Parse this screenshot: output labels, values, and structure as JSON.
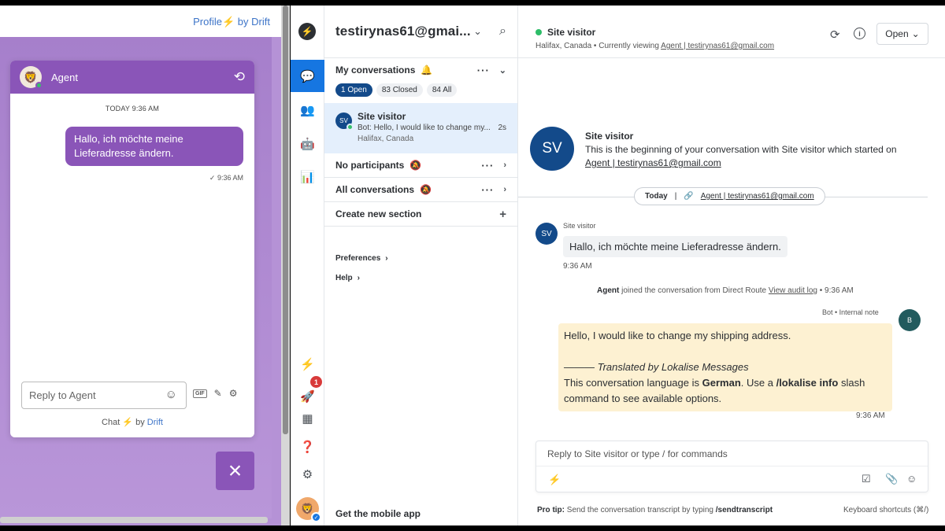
{
  "preview": {
    "profile_label": "Profile",
    "by_label": "by",
    "brand": "Drift",
    "widget": {
      "agent_name": "Agent",
      "date_label": "TODAY 9:36 AM",
      "message": "Hallo, ich möchte meine Lieferadresse ändern.",
      "message_time": "9:36 AM",
      "input_placeholder": "Reply to Agent",
      "gif_label": "GIF",
      "footer_chat": "Chat",
      "footer_by": "by",
      "footer_brand": "Drift"
    },
    "close_icon": "×"
  },
  "rail": {
    "badge_count": "1",
    "accent": "#1676e1"
  },
  "convlist": {
    "account": "testirynas61@gmai...",
    "my_conversations": "My conversations",
    "pills": [
      "1 Open",
      "83 Closed",
      "84 All"
    ],
    "conversation": {
      "avatar": "SV",
      "name": "Site visitor",
      "preview": "Bot: Hello, I would like to change my...",
      "location": "Halifax, Canada",
      "ago": "2s"
    },
    "no_participants": "No participants",
    "all_conversations": "All conversations",
    "create_section": "Create new section",
    "preferences": "Preferences",
    "help": "Help",
    "mobile": "Get the mobile app"
  },
  "main": {
    "visitor_name": "Site visitor",
    "location": "Halifax, Canada",
    "currently_viewing": "Currently viewing",
    "viewing_link": "Agent | testirynas61@gmail.com",
    "open_label": "Open",
    "intro": {
      "avatar": "SV",
      "name": "Site visitor",
      "text": "This is the beginning of your conversation with Site visitor which started on",
      "link": "Agent | testirynas61@gmail.com"
    },
    "day_chip": {
      "day": "Today",
      "sep": "|",
      "link": "Agent | testirynas61@gmail.com"
    },
    "visitor_msg": {
      "avatar": "SV",
      "name": "Site visitor",
      "text": "Hallo, ich möchte meine Lieferadresse ändern.",
      "time": "9:36 AM"
    },
    "join": {
      "who": "Agent",
      "text": "joined the conversation from Direct Route",
      "link": "View audit log",
      "time": "• 9:36 AM"
    },
    "bot_note": {
      "meta": "Bot • Internal note",
      "avatar": "B",
      "line1": "Hello, I would like to change my shipping address.",
      "line2": "——— Translated by Lokalise Messages",
      "line3_a": "This conversation language is",
      "line3_b": "German",
      "line3_c": ". Use a",
      "line3_d": "/lokalise info",
      "line3_e": "slash",
      "line4": "command to see available options.",
      "time": "9:36 AM"
    },
    "composer_placeholder": "Reply to Site visitor or type / for commands",
    "tip_label": "Pro tip:",
    "tip_text": "Send the conversation transcript by typing",
    "tip_cmd": "/sendtranscript",
    "shortcuts": "Keyboard shortcuts (⌘/)"
  }
}
